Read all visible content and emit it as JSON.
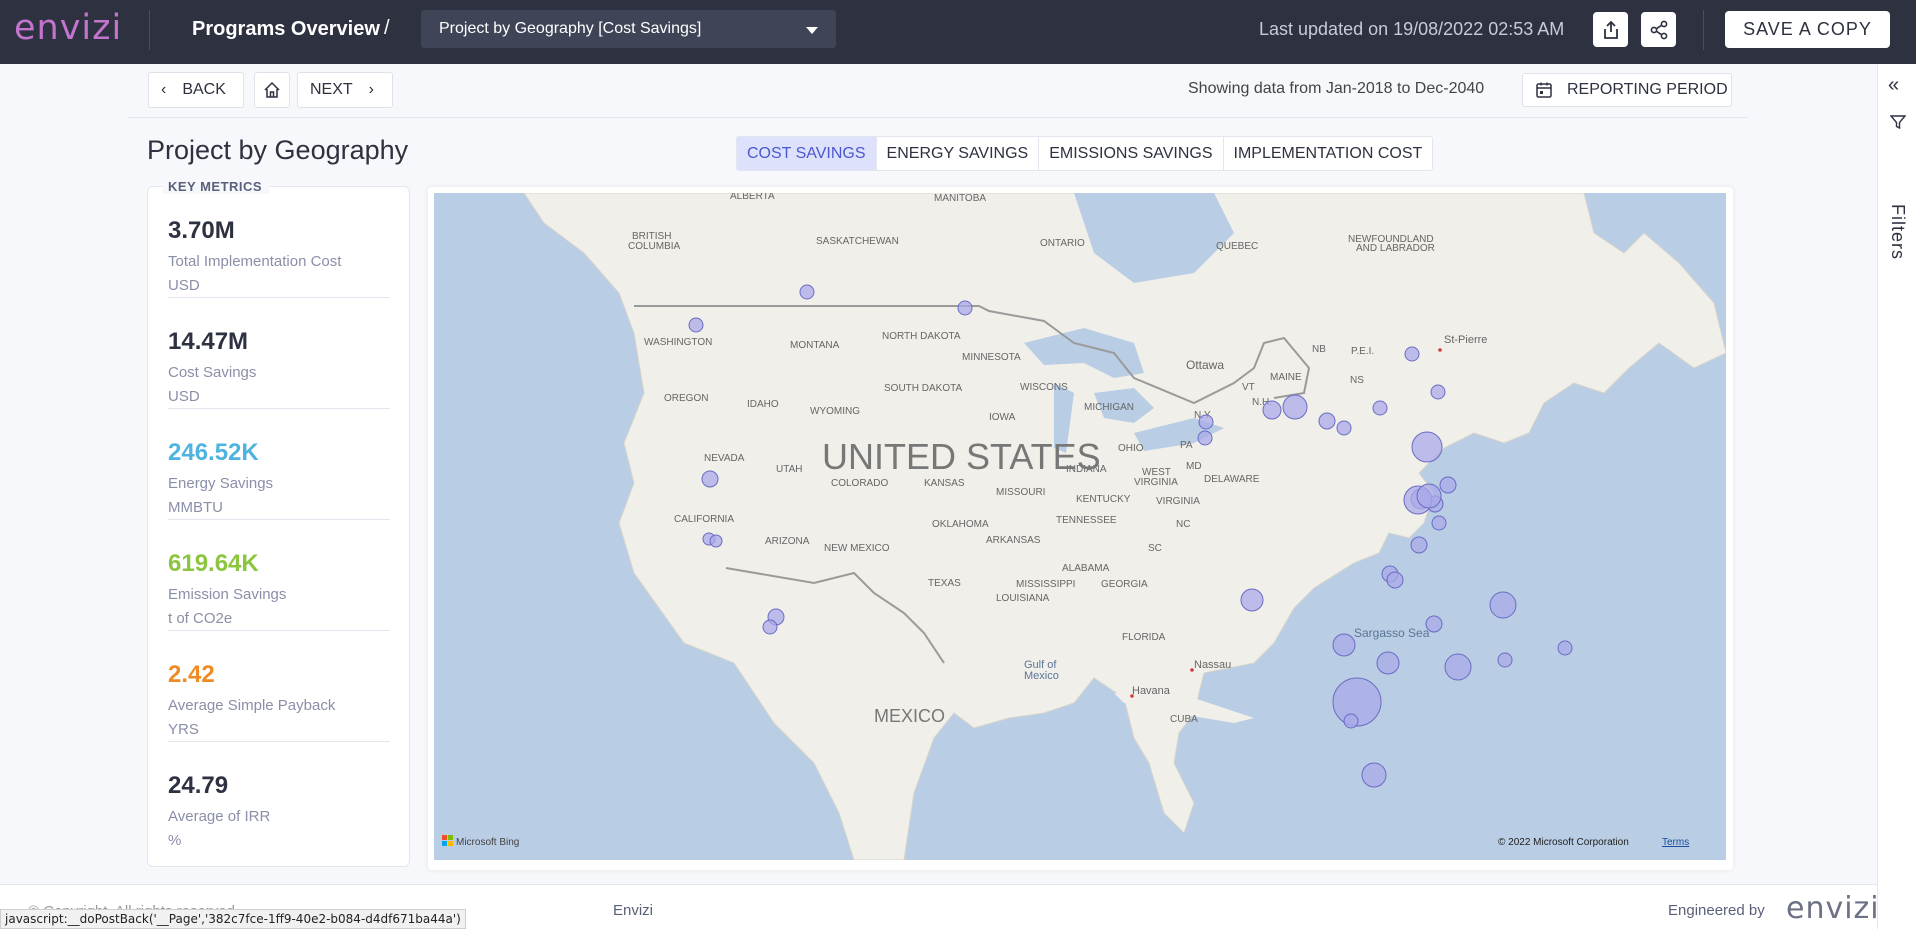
{
  "header": {
    "logo": "envizi",
    "programs_title": "Programs Overview",
    "slash": "/",
    "report_select": "Project by Geography [Cost Savings]",
    "last_updated": "Last updated on 19/08/2022 02:53 AM",
    "save_copy": "SAVE A COPY"
  },
  "nav": {
    "back": "BACK",
    "next": "NEXT",
    "showing": "Showing data from Jan-2018 to Dec-2040",
    "reporting_period": "REPORTING PERIOD",
    "filters": "Filters"
  },
  "page": {
    "title": "Project by Geography",
    "tabs": [
      "COST SAVINGS",
      "ENERGY SAVINGS",
      "EMISSIONS SAVINGS",
      "IMPLEMENTATION COST"
    ],
    "active_tab": "COST SAVINGS"
  },
  "metrics": {
    "heading": "KEY METRICS",
    "items": [
      {
        "value": "3.70M",
        "label": "Total Implementation Cost",
        "unit": "USD",
        "color": "#2d3140"
      },
      {
        "value": "14.47M",
        "label": "Cost Savings",
        "unit": "USD",
        "color": "#2d3140"
      },
      {
        "value": "246.52K",
        "label": "Energy Savings",
        "unit": "MMBTU",
        "color": "#4fb3e0"
      },
      {
        "value": "619.64K",
        "label": "Emission Savings",
        "unit": "t of CO2e",
        "color": "#8cc63f"
      },
      {
        "value": "2.42",
        "label": "Average Simple Payback",
        "unit": "YRS",
        "color": "#f08a24"
      },
      {
        "value": "24.79",
        "label": "Average of IRR",
        "unit": "%",
        "color": "#2d3140"
      }
    ]
  },
  "map": {
    "country_label": "UNITED STATES",
    "labels": {
      "alberta": "ALBERTA",
      "manitoba": "MANITOBA",
      "bc": "BRITISH COLUMBIA",
      "saskatchewan": "SASKATCHEWAN",
      "ontario": "ONTARIO",
      "quebec": "QUEBEC",
      "newfoundland": "NEWFOUNDLAND AND LABRADOR",
      "washington": "WASHINGTON",
      "montana": "MONTANA",
      "north_dakota": "NORTH DAKOTA",
      "minnesota": "MINNESOTA",
      "oregon": "OREGON",
      "idaho": "IDAHO",
      "south_dakota": "SOUTH DAKOTA",
      "wisconsin": "WISCONS",
      "michigan": "MICHIGAN",
      "wyoming": "WYOMING",
      "iowa": "IOWA",
      "nevada": "NEVADA",
      "utah": "UTAH",
      "colorado": "COLORADO",
      "kansas": "KANSAS",
      "missouri": "MISSOURI",
      "indiana": "INDIANA",
      "ohio": "OHIO",
      "pa": "PA",
      "ny": "N.Y.",
      "west_virginia": "WEST VIRGINIA",
      "virginia": "VIRGINIA",
      "kentucky": "KENTUCKY",
      "delaware": "DELAWARE",
      "md": "MD",
      "california": "CALIFORNIA",
      "arizona": "ARIZONA",
      "new_mexico": "NEW MEXICO",
      "oklahoma": "OKLAHOMA",
      "arkansas": "ARKANSAS",
      "tennessee": "TENNESSEE",
      "nc": "NC",
      "sc": "SC",
      "texas": "TEXAS",
      "mississippi": "MISSISSIPPI",
      "alabama": "ALABAMA",
      "georgia": "GEORGIA",
      "louisiana": "LOUISIANA",
      "florida": "FLORIDA",
      "maine": "MAINE",
      "vt": "VT",
      "nh": "N.H.",
      "nb": "NB",
      "pei": "P.E.I.",
      "ns": "NS",
      "ottawa": "Ottawa",
      "st_pierre": "St-Pierre",
      "sargasso": "Sargasso Sea",
      "gulf": "Gulf of Mexico",
      "nassau": "Nassau",
      "havana": "Havana",
      "cuba": "CUBA",
      "mexico": "MEXICO"
    },
    "attribution": "© 2022 Microsoft Corporation",
    "terms": "Terms",
    "bing": "Microsoft Bing"
  },
  "footer": {
    "copyright": "© Copyright. All rights reserved.",
    "center": "Envizi",
    "engineered": "Engineered by",
    "logo": "envizi",
    "statusbar": "javascript:__doPostBack('__Page','382c7fce-1ff9-40e2-b084-d4df671ba44a')"
  },
  "colors": {
    "topbar": "#2d3140",
    "accent": "#4b57cf",
    "bubble_fill": "#a9a9e8",
    "bubble_stroke": "#6b6bc4"
  }
}
